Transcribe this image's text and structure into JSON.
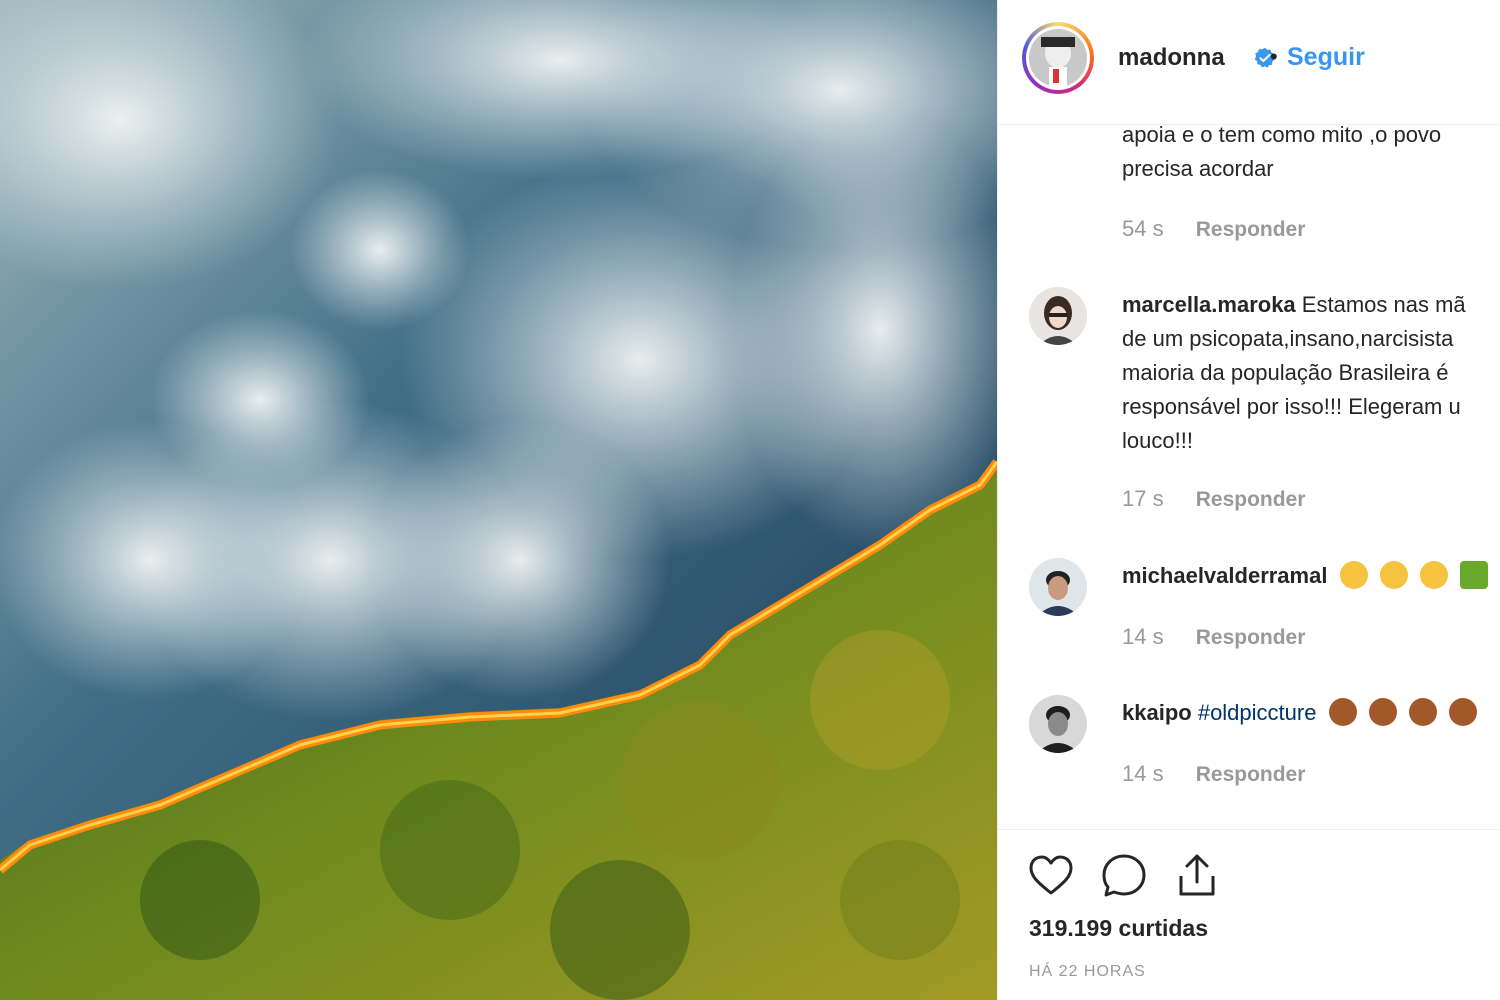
{
  "post": {
    "image_alt": "Amazon forest fire aerial view",
    "author": "madonna",
    "separator": "•",
    "follow_label": "Seguir",
    "likes": "319.199 curtidas",
    "time_ago": "HÁ 22 HORAS"
  },
  "comments": [
    {
      "username": "",
      "text_lines": [
        "apoia e o tem como mito ,o povo",
        "precisa acordar"
      ],
      "age": "54 s",
      "reply_label": "Responder"
    },
    {
      "username": "marcella.maroka",
      "text_lines": [
        "Estamos nas mã",
        "de um psicopata,insano,narcisista",
        "maioria da população Brasileira é",
        "responsável por isso!!! Elegeram u",
        "louco!!!"
      ],
      "age": "17 s",
      "reply_label": "Responder"
    },
    {
      "username": "michaelvalderramal",
      "text_lines": [
        ""
      ],
      "age": "14 s",
      "reply_label": "Responder"
    },
    {
      "username": "kkaipo",
      "text_lines": [
        "#oldpiccture"
      ],
      "age": "14 s",
      "reply_label": "Responder"
    }
  ],
  "colors": {
    "link_blue": "#3897f0",
    "text_dark": "#262626",
    "text_muted": "#999999"
  }
}
